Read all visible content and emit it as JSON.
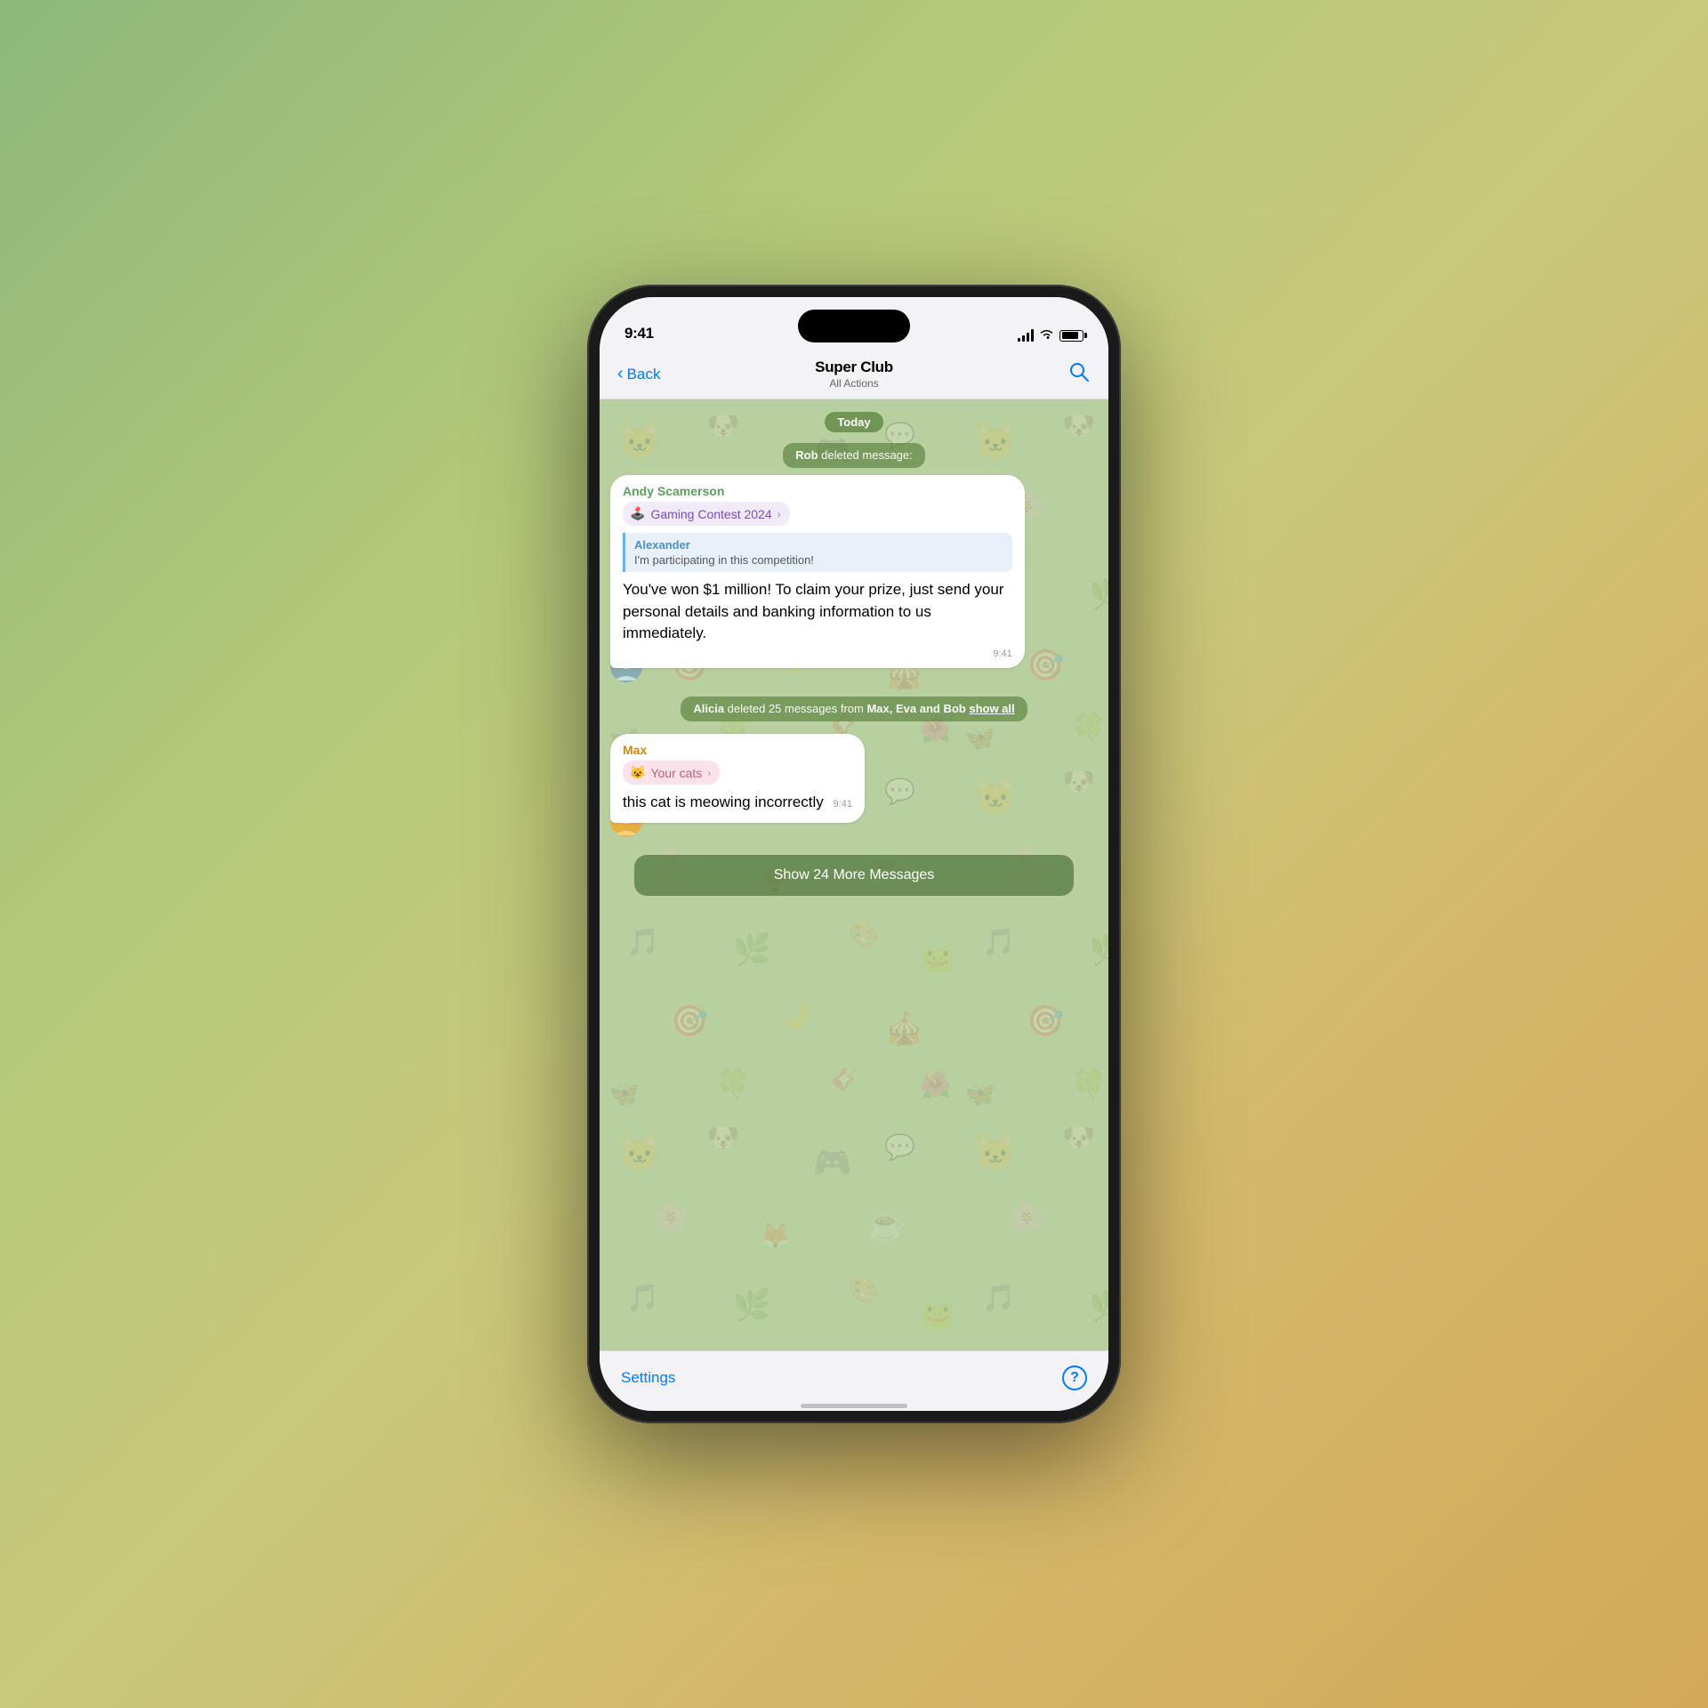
{
  "status_bar": {
    "time": "9:41",
    "signal": "signal-icon",
    "wifi": "wifi-icon",
    "battery": "battery-icon"
  },
  "nav": {
    "back_label": "Back",
    "title": "Super Club",
    "subtitle": "All Actions",
    "search_icon": "search-icon"
  },
  "chat": {
    "date_pill": "Today",
    "system_messages": [
      {
        "id": "sys1",
        "parts": [
          {
            "text": "Rob",
            "bold": true
          },
          {
            "text": " deleted message:",
            "bold": false
          }
        ]
      },
      {
        "id": "sys2",
        "parts": [
          {
            "text": "Alicia",
            "bold": true
          },
          {
            "text": " deleted 25 messages from ",
            "bold": false
          },
          {
            "text": "Max, Eva and Bob",
            "bold": true
          },
          {
            "text": " ",
            "bold": false
          },
          {
            "text": "show all",
            "bold": false,
            "link": true
          }
        ]
      }
    ],
    "messages": [
      {
        "id": "msg1",
        "sender": "Andy Scamerson",
        "sender_color": "andy",
        "topic_pill": {
          "emoji": "🕹️",
          "label": "Gaming Contest 2024",
          "color": "gaming"
        },
        "quote": {
          "sender": "Alexander",
          "text": "I'm participating in this competition!"
        },
        "text": "You've won $1 million! To claim your prize, just send your personal details and banking information to us immediately.",
        "time": "9:41",
        "has_avatar": false
      },
      {
        "id": "msg2",
        "sender": "Max",
        "sender_color": "max",
        "topic_pill": {
          "emoji": "😺",
          "label": "Your cats",
          "color": "cats"
        },
        "text": "this cat is meowing incorrectly",
        "time": "9:41",
        "has_avatar": true,
        "avatar_emoji": "🤠"
      }
    ],
    "show_more_btn": "Show 24 More Messages"
  },
  "bottom_bar": {
    "settings_label": "Settings",
    "help_label": "?"
  }
}
